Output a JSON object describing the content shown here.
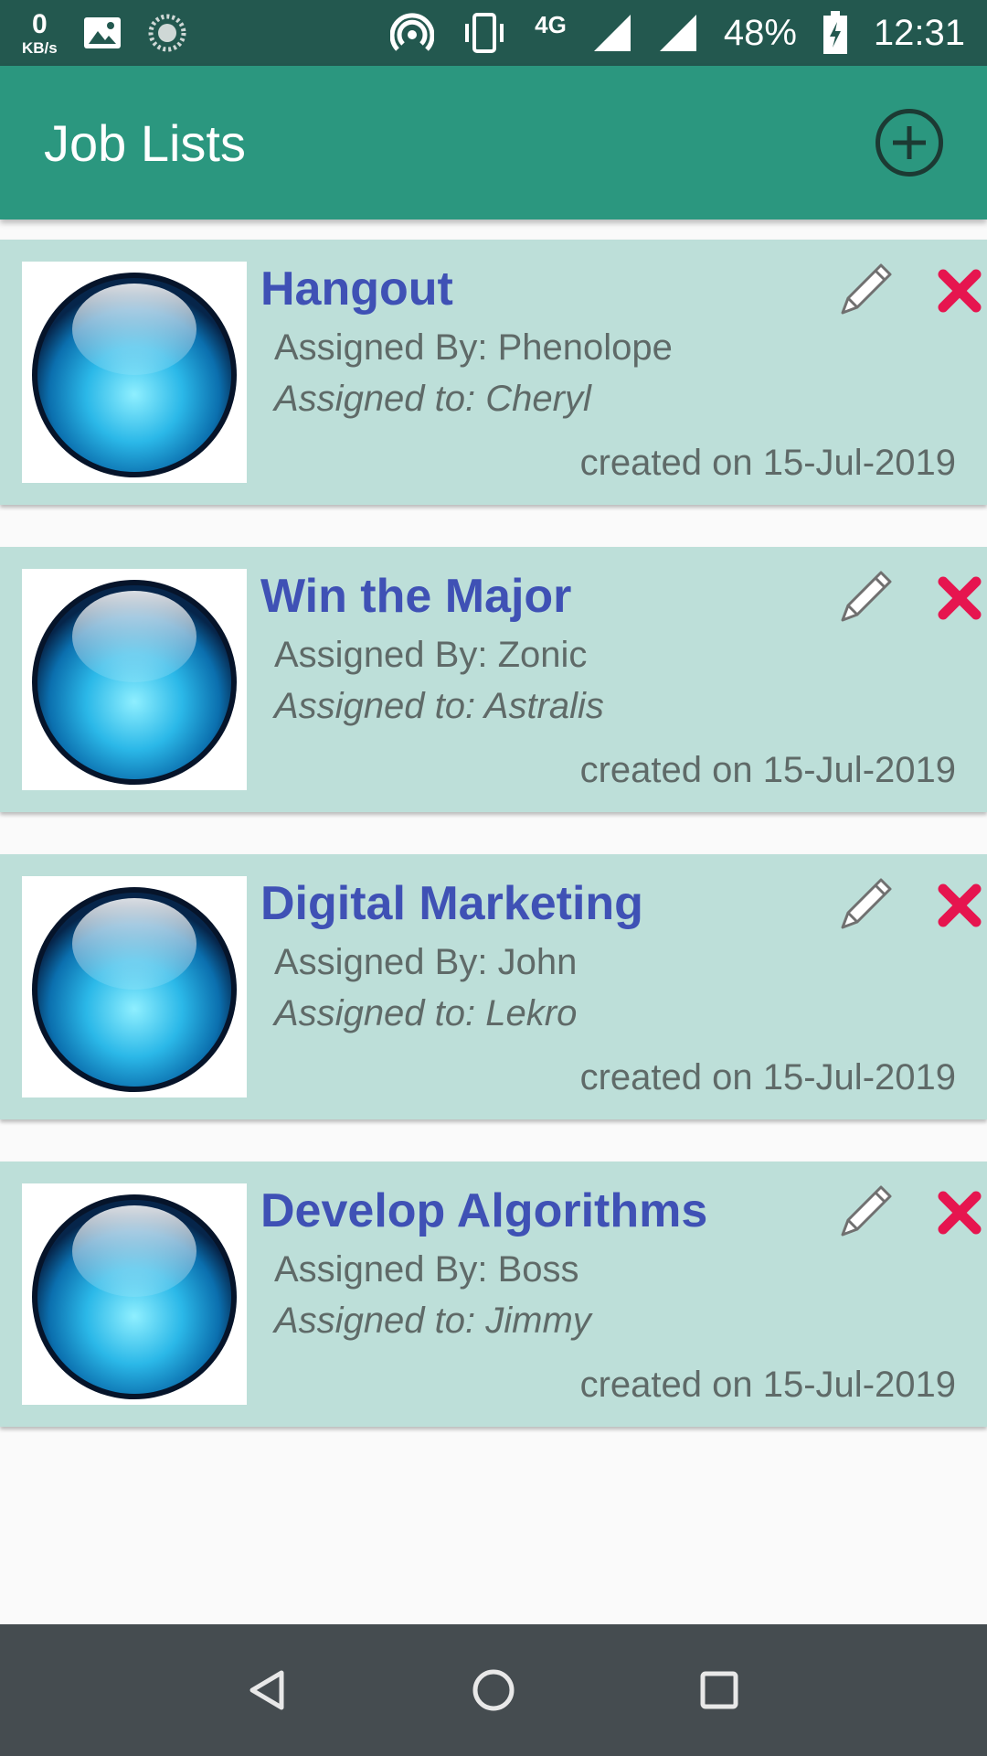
{
  "status_bar": {
    "kbs_value": "0",
    "kbs_unit": "KB/s",
    "network": "4G",
    "battery": "48%",
    "time": "12:31"
  },
  "app_bar": {
    "title": "Job Lists",
    "add_icon": "add-circle-icon"
  },
  "jobs": [
    {
      "title": "Hangout",
      "assigned_by": "Assigned By:  Phenolope",
      "assigned_to": "Assigned to:  Cheryl",
      "created": "created on  15-Jul-2019"
    },
    {
      "title": "Win the Major",
      "assigned_by": "Assigned By:  Zonic",
      "assigned_to": "Assigned to:  Astralis",
      "created": "created on  15-Jul-2019"
    },
    {
      "title": "Digital Marketing",
      "assigned_by": "Assigned By:  John",
      "assigned_to": "Assigned to:  Lekro",
      "created": "created on  15-Jul-2019"
    },
    {
      "title": "Develop Algorithms",
      "assigned_by": "Assigned By:  Boss",
      "assigned_to": "Assigned to:  Jimmy",
      "created": "created on  15-Jul-2019"
    }
  ],
  "colors": {
    "status_bar": "#23584f",
    "app_bar": "#2b977f",
    "card_bg": "#bddfd9",
    "title_text": "#3f51b5",
    "delete_red": "#e6154f",
    "nav_bar": "#454c50"
  },
  "nav": {
    "back_icon": "back-triangle-icon",
    "home_icon": "home-circle-icon",
    "recents_icon": "recents-square-icon"
  }
}
